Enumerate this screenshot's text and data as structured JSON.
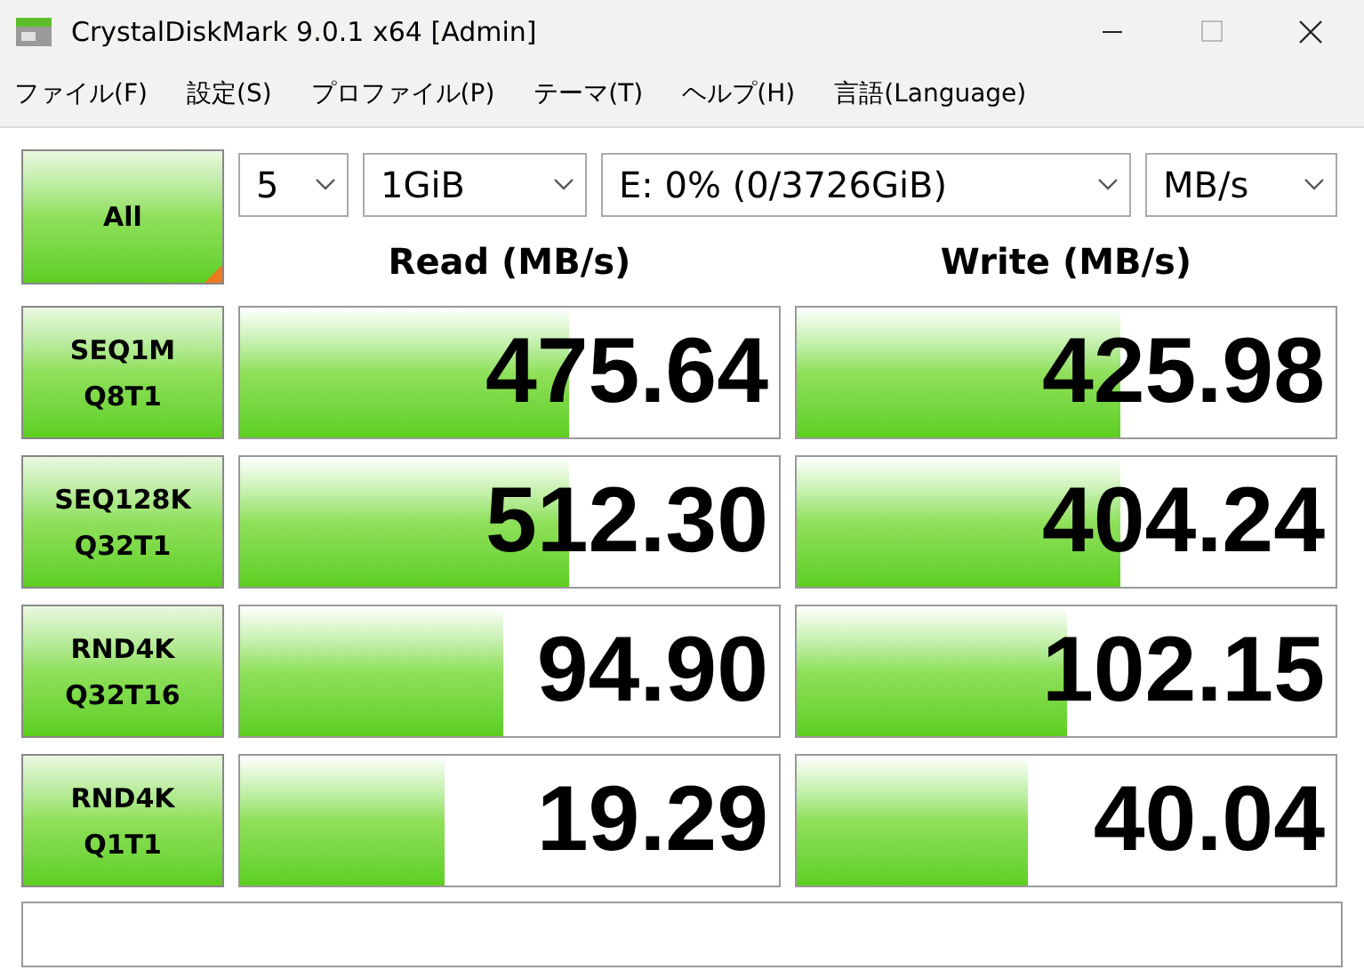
{
  "window": {
    "title": "CrystalDiskMark 9.0.1 x64 [Admin]"
  },
  "menu": [
    "ファイル(F)",
    "設定(S)",
    "プロファイル(P)",
    "テーマ(T)",
    "ヘルプ(H)",
    "言語(Language)"
  ],
  "all_button": {
    "label": "All"
  },
  "selectors": [
    {
      "value": "5"
    },
    {
      "value": "1GiB"
    },
    {
      "value": "E: 0% (0/3726GiB)"
    },
    {
      "value": "MB/s"
    }
  ],
  "columns": [
    "Read (MB/s)",
    "Write (MB/s)"
  ],
  "rows": [
    {
      "test": [
        "SEQ1M",
        "Q8T1"
      ],
      "read": {
        "value": "475.64",
        "level": 0.61
      },
      "write": {
        "value": "425.98",
        "level": 0.6
      }
    },
    {
      "test": [
        "SEQ128K",
        "Q32T1"
      ],
      "read": {
        "value": "512.30",
        "level": 0.61
      },
      "write": {
        "value": "404.24",
        "level": 0.6
      }
    },
    {
      "test": [
        "RND4K",
        "Q32T16"
      ],
      "read": {
        "value": "94.90",
        "level": 0.49
      },
      "write": {
        "value": "102.15",
        "level": 0.5
      }
    },
    {
      "test": [
        "RND4K",
        "Q1T1"
      ],
      "read": {
        "value": "19.29",
        "level": 0.38
      },
      "write": {
        "value": "40.04",
        "level": 0.43
      }
    }
  ]
}
